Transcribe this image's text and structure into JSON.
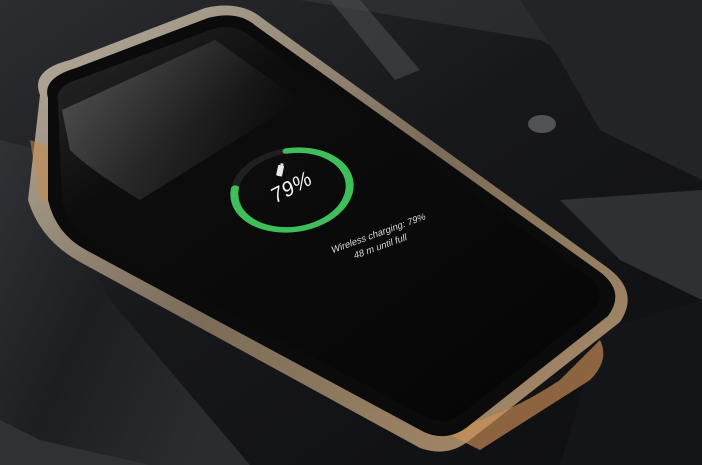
{
  "charging_screen": {
    "percent_label": "79%",
    "status_line": "Wireless charging: 79%",
    "time_line": "48 m until full",
    "charge_fraction": 0.79,
    "ring_color": "#3fbf5a",
    "ring_track_color": "#1f1f1f",
    "icon": "battery-charging-icon"
  },
  "colors": {
    "console_dark": "#1b1c1f",
    "phone_case_orange": "#c8813f",
    "screen_black": "#070707"
  }
}
